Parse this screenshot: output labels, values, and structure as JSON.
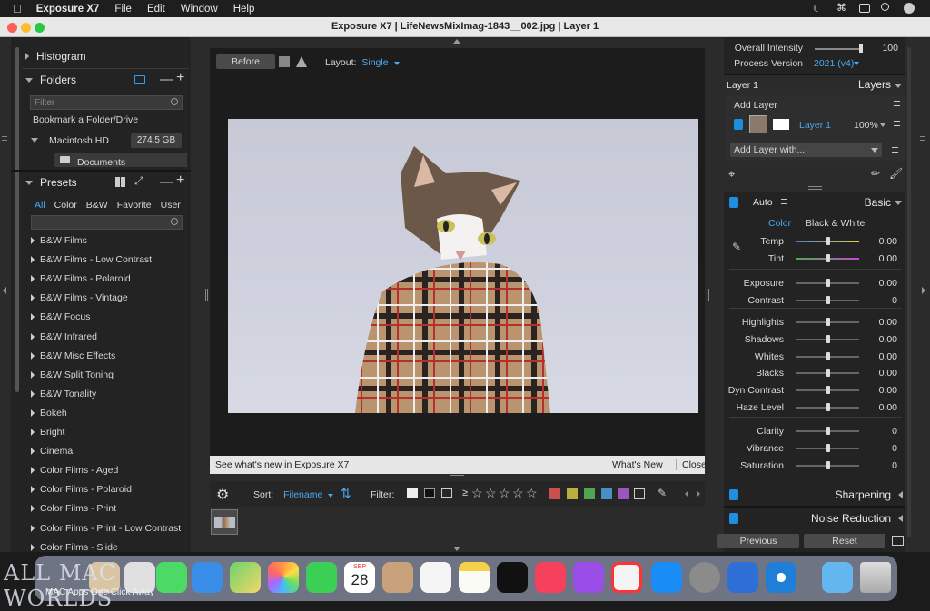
{
  "menubar": {
    "app": "Exposure X7",
    "items": [
      "File",
      "Edit",
      "Window",
      "Help"
    ]
  },
  "window": {
    "title": "Exposure X7 | LifeNewsMixImag-1843__002.jpg | Layer 1"
  },
  "left": {
    "histogram": "Histogram",
    "folders": "Folders",
    "filter_placeholder": "Filter",
    "bookmark": "Bookmark a Folder/Drive",
    "drive": "Macintosh HD",
    "drive_size": "274.5 GB",
    "documents": "Documents",
    "presets": "Presets",
    "preset_tabs": [
      "All",
      "Color",
      "B&W",
      "Favorite",
      "User"
    ],
    "preset_items": [
      "B&W Films",
      "B&W Films - Low Contrast",
      "B&W Films - Polaroid",
      "B&W Films - Vintage",
      "B&W Focus",
      "B&W Infrared",
      "B&W Misc Effects",
      "B&W Split Toning",
      "B&W Tonality",
      "Bokeh",
      "Bright",
      "Cinema",
      "Color Films - Aged",
      "Color Films - Polaroid",
      "Color Films - Print",
      "Color Films - Print - Low Contrast",
      "Color Films - Slide"
    ]
  },
  "center": {
    "before": "Before",
    "layout_label": "Layout:",
    "layout_value": "Single",
    "news": "See what's new in Exposure X7",
    "whats_new": "What's New",
    "close": "Close",
    "sort_label": "Sort:",
    "sort_value": "Filename",
    "filter_label": "Filter:",
    "rating_prefix": "≥",
    "color_labels": [
      "#c9504b",
      "#b9b03c",
      "#4fa552",
      "#4a8fc4",
      "#9a56bc"
    ]
  },
  "right": {
    "overall_intensity": "Overall Intensity",
    "overall_value": "100",
    "overall_level": 0.98,
    "process_version": "Process Version",
    "process_value": "2021 (v4)",
    "layer1": "Layer 1",
    "layers": "Layers",
    "add_layer": "Add Layer",
    "layer_name": "Layer 1",
    "layer_opacity": "100%",
    "add_layer_with": "Add Layer with...",
    "auto": "Auto",
    "basic": "Basic",
    "color_tab": "Color",
    "bw_tab": "Black & White",
    "sliders": [
      {
        "label": "Temp",
        "value": "0.00"
      },
      {
        "label": "Tint",
        "value": "0.00"
      },
      {
        "label": "Exposure",
        "value": "0.00"
      },
      {
        "label": "Contrast",
        "value": "0"
      },
      {
        "label": "Highlights",
        "value": "0.00"
      },
      {
        "label": "Shadows",
        "value": "0.00"
      },
      {
        "label": "Whites",
        "value": "0.00"
      },
      {
        "label": "Blacks",
        "value": "0.00"
      },
      {
        "label": "Dyn Contrast",
        "value": "0.00"
      },
      {
        "label": "Haze Level",
        "value": "0.00"
      },
      {
        "label": "Clarity",
        "value": "0"
      },
      {
        "label": "Vibrance",
        "value": "0"
      },
      {
        "label": "Saturation",
        "value": "0"
      }
    ],
    "sharpening": "Sharpening",
    "noise_reduction": "Noise Reduction",
    "previous": "Previous",
    "reset": "Reset"
  },
  "dock": {
    "calendar_month": "SEP",
    "calendar_day": "28"
  },
  "watermark": {
    "title": "ALL MAC WORLDS",
    "sub": "MAC Apps One Click Away"
  }
}
